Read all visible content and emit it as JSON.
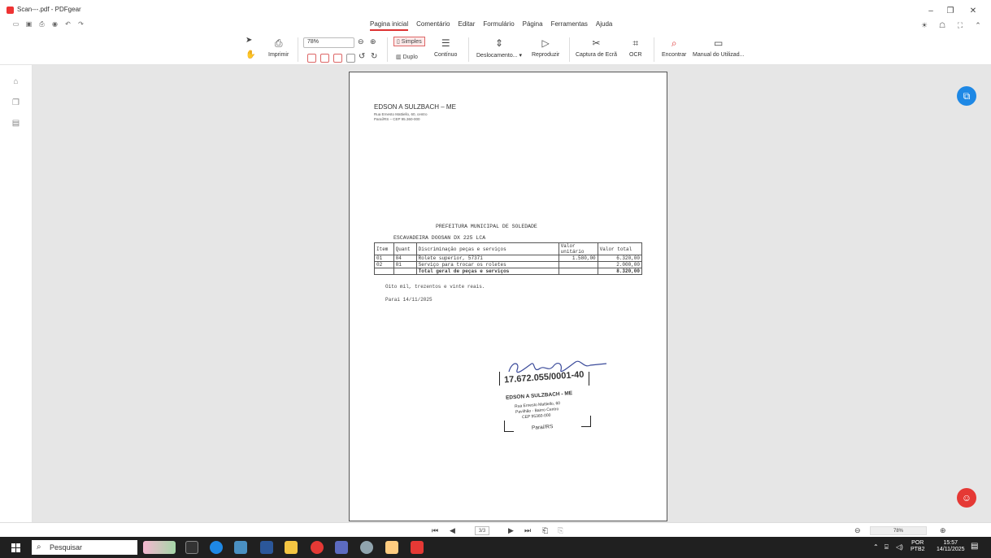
{
  "window": {
    "title": "Scan---.pdf - PDFgear"
  },
  "menu": {
    "items": [
      "Pagina inicial",
      "Comentário",
      "Editar",
      "Formulário",
      "Página",
      "Ferramentas",
      "Ajuda"
    ]
  },
  "toolbar": {
    "print_label": "Imprimir",
    "zoom_value": "78%",
    "single_label": "Simples",
    "double_label": "Duplo",
    "continuous_label": "Contínuo",
    "scroll_label": "Deslocamento...",
    "play_label": "Reproduzir",
    "capture_label": "Captura de Ecrã",
    "ocr_label": "OCR",
    "find_label": "Encontrar",
    "manual_label": "Manual do Utilizad..."
  },
  "document": {
    "header_name": "EDSON A SULZBACH – ME",
    "header_addr1": "Rua Ernesto Mattiello, 60, centro",
    "header_addr2": "Paraí/RS – CEP 95.360-000",
    "prefeitura": "PREFEITURA MUNICIPAL DE SOLEDADE",
    "subject": "ESCAVADEIRA DOOSAN DX 225 LCA",
    "table": {
      "headers": [
        "Item",
        "Quant",
        "Discriminação peças e serviços",
        "Valor unitário",
        "Valor total"
      ],
      "rows": [
        [
          "01",
          "04",
          "Rolete superior, 57371",
          "1.580,00",
          "6.320,00"
        ],
        [
          "02",
          "01",
          "Serviço para trocar os roletes",
          "",
          "2.000,00"
        ]
      ],
      "total_label": "Total geral de peças e serviços",
      "total_value": "8.320,00"
    },
    "amount_words": "Oito mil, trezentos e vinte reais.",
    "place_date": "Paraí 14/11/2025",
    "stamp": {
      "cnpj": "17.672.055/0001-40",
      "name": "EDSON A SULZBACH - ME",
      "line1": "Rua Ernesto Mattiello, 60",
      "line2": "Pavilhão - Bairro Centro",
      "line3": "CEP 95360-000",
      "city": "Paraí/RS"
    }
  },
  "pagebar": {
    "page": "3/3",
    "zoom": "78%"
  },
  "taskbar": {
    "search_placeholder": "Pesquisar",
    "lang1": "POR",
    "lang2": "PTB2",
    "time": "15:57",
    "date": "14/11/2025"
  },
  "colors": {
    "accent": "#d33333",
    "fab_blue": "#1e88e5",
    "fab_red": "#e53935",
    "workspace": "#e6e6e6"
  }
}
